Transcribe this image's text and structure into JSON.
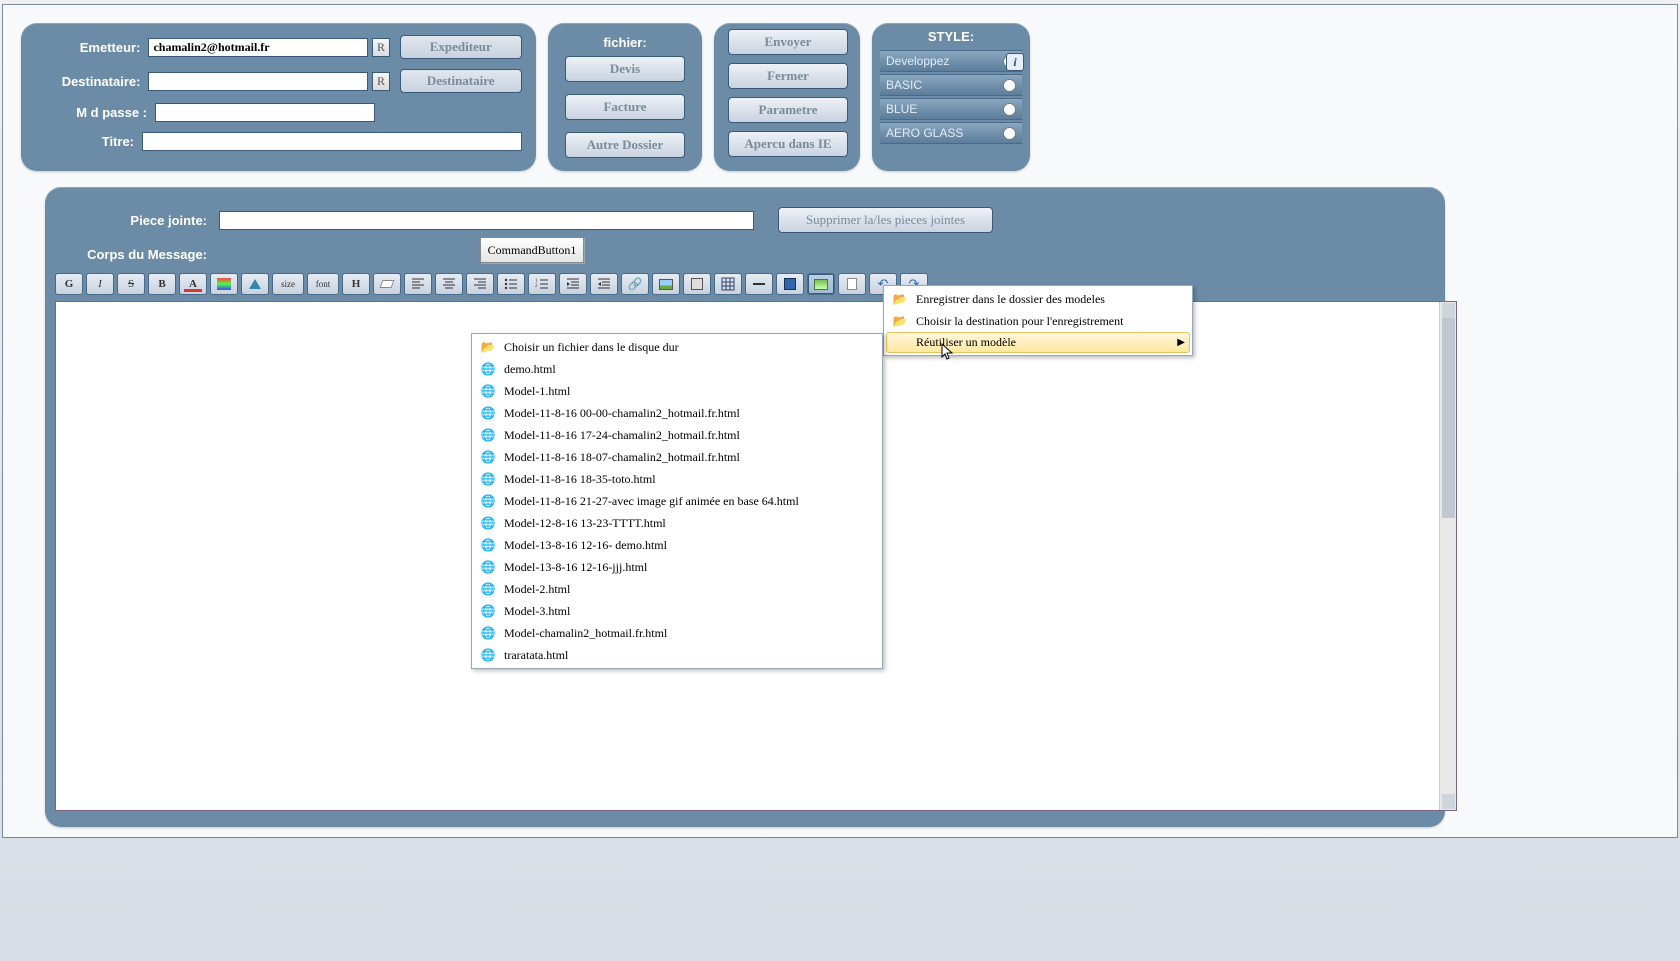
{
  "form": {
    "emetteur_label": "Emetteur:",
    "emetteur_value": "chamalin2@hotmail.fr",
    "destinataire_label": "Destinataire:",
    "destinataire_value": "",
    "mdp_label": "M d passe  :",
    "mdp_value": "",
    "titre_label": "Titre:",
    "titre_value": "",
    "r_btn": "R",
    "expediteur_btn": "Expediteur",
    "destinataire_btn": "Destinataire"
  },
  "fichier": {
    "title": "fichier:",
    "devis": "Devis",
    "facture": "Facture",
    "autre": "Autre Dossier"
  },
  "actions": {
    "envoyer": "Envoyer",
    "fermer": "Fermer",
    "parametre": "Parametre",
    "apercu": "Apercu  dans IE"
  },
  "style": {
    "title": "STYLE:",
    "opts": [
      "Developpez",
      "BASIC",
      "BLUE",
      "AERO GLASS"
    ]
  },
  "message": {
    "piece_jointe_label": "Piece jointe:",
    "corps_label": "Corps du Message:",
    "supprimer_btn": "Supprimer la/les pieces jointes",
    "command_btn": "CommandButton1"
  },
  "toolbar": {
    "g": "G",
    "i": "I",
    "s": "S",
    "b": "B",
    "a": "A",
    "size": "size",
    "font": "font",
    "h": "H"
  },
  "context_menu_main": [
    {
      "icon": "folder",
      "label": "Enregistrer dans le dossier des modeles",
      "arrow": false,
      "hover": false
    },
    {
      "icon": "folder",
      "label": "Choisir la destination pour l'enregistrement",
      "arrow": false,
      "hover": false
    },
    {
      "icon": "",
      "label": "Réutiliser un modèle",
      "arrow": true,
      "hover": true
    }
  ],
  "context_menu_files": [
    {
      "icon": "folder",
      "label": "Choisir un fichier dans le disque dur"
    },
    {
      "icon": "world",
      "label": "demo.html"
    },
    {
      "icon": "world",
      "label": "Model-1.html"
    },
    {
      "icon": "world",
      "label": "Model-11-8-16 00-00-chamalin2_hotmail.fr.html"
    },
    {
      "icon": "world",
      "label": "Model-11-8-16 17-24-chamalin2_hotmail.fr.html"
    },
    {
      "icon": "world",
      "label": "Model-11-8-16 18-07-chamalin2_hotmail.fr.html"
    },
    {
      "icon": "world",
      "label": "Model-11-8-16 18-35-toto.html"
    },
    {
      "icon": "world",
      "label": "Model-11-8-16 21-27-avec image gif animée en base 64.html"
    },
    {
      "icon": "world",
      "label": "Model-12-8-16 13-23-TTTT.html"
    },
    {
      "icon": "world",
      "label": "Model-13-8-16 12-16- demo.html"
    },
    {
      "icon": "world",
      "label": "Model-13-8-16 12-16-jjj.html"
    },
    {
      "icon": "world",
      "label": "Model-2.html"
    },
    {
      "icon": "world",
      "label": "Model-3.html"
    },
    {
      "icon": "world",
      "label": "Model-chamalin2_hotmail.fr.html"
    },
    {
      "icon": "world",
      "label": "traratata.html"
    }
  ]
}
